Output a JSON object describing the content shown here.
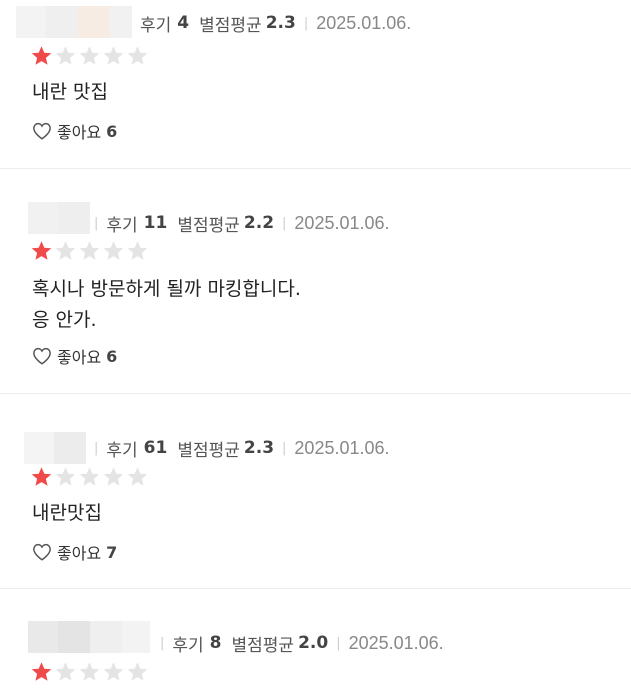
{
  "labels": {
    "review_count": "후기",
    "rating_avg": "별점평균",
    "like": "좋아요"
  },
  "colors": {
    "star_filled": "#f04a4a",
    "star_empty": "#e4e4e4",
    "avatar_blur": [
      "#f1f1f1",
      "#f5ebe2",
      "#eeeeee"
    ]
  },
  "reviews": [
    {
      "review_count": "4",
      "rating_avg": "2.3",
      "date": "2025.01.06.",
      "rating": 1,
      "text": "내란 맛집",
      "likes": "6"
    },
    {
      "review_count": "11",
      "rating_avg": "2.2",
      "date": "2025.01.06.",
      "rating": 1,
      "text": "혹시나 방문하게 될까 마킹합니다.\n응 안가.",
      "likes": "6"
    },
    {
      "review_count": "61",
      "rating_avg": "2.3",
      "date": "2025.01.06.",
      "rating": 1,
      "text": "내란맛집",
      "likes": "7"
    },
    {
      "review_count": "8",
      "rating_avg": "2.0",
      "date": "2025.01.06.",
      "rating": 1,
      "text": "",
      "likes": ""
    }
  ]
}
